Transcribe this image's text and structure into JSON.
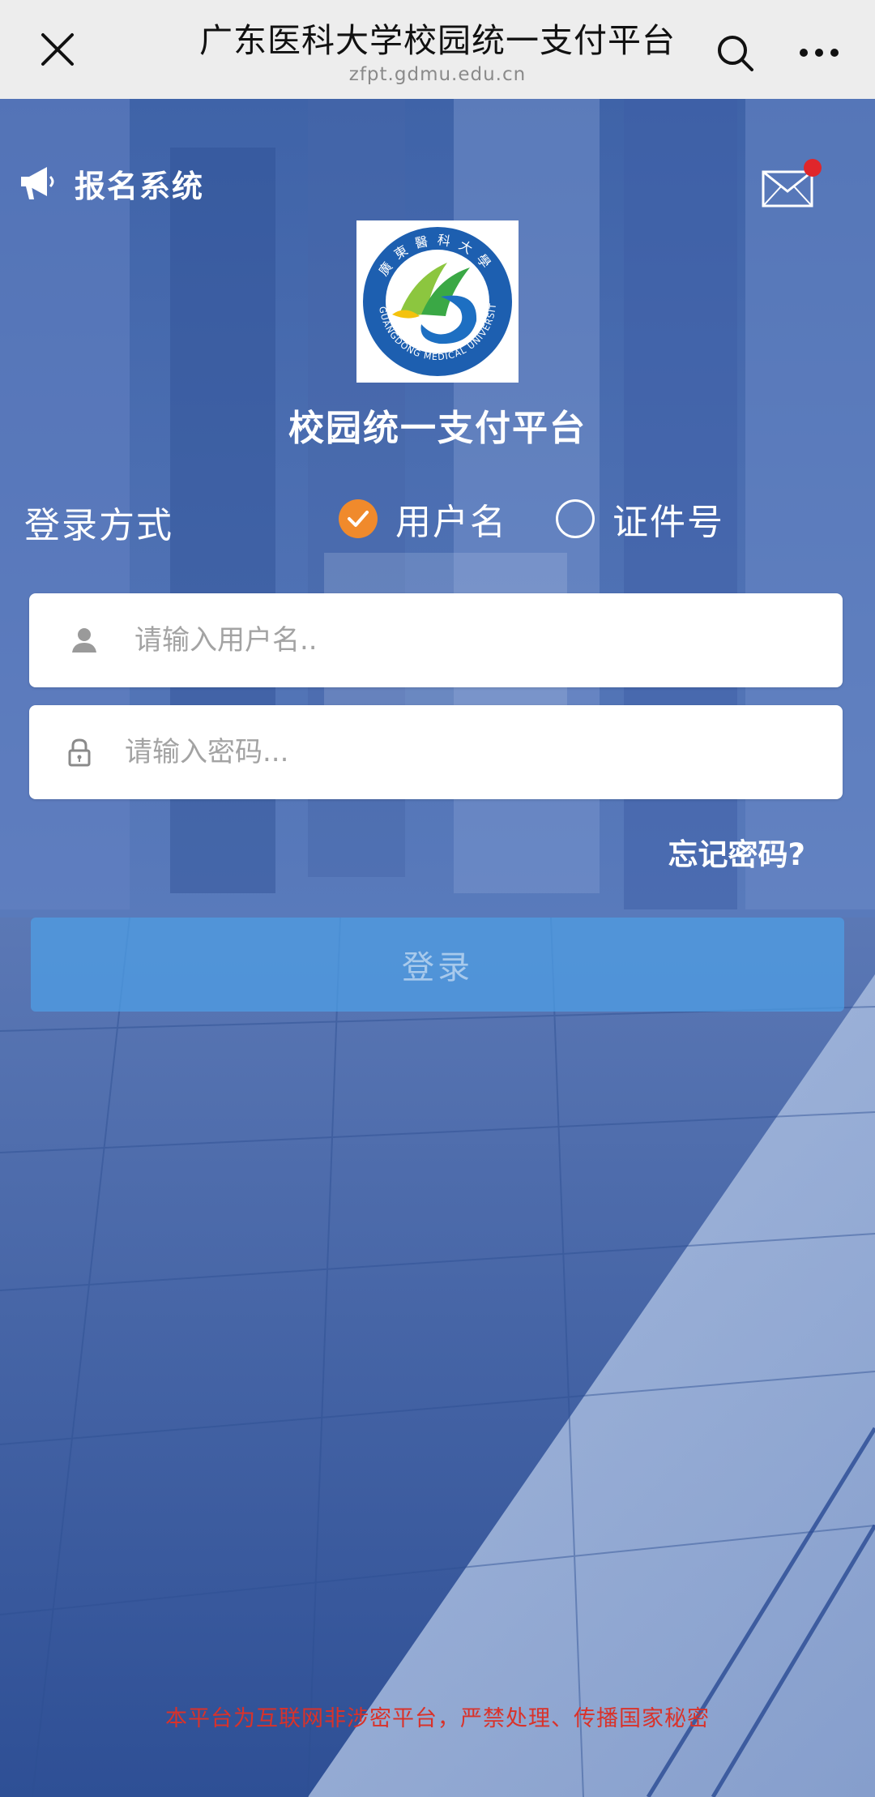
{
  "browser": {
    "title": "广东医科大学校园统一支付平台",
    "url": "zfpt.gdmu.edu.cn"
  },
  "header": {
    "system_label": "报名系统"
  },
  "logo": {
    "ring_text": "GUANGDONG MEDICAL UNIVERSITY",
    "calligraphy": "廣東醫科大學"
  },
  "app_title": "校园统一支付平台",
  "login": {
    "method_label": "登录方式",
    "options": [
      {
        "label": "用户名",
        "checked": true
      },
      {
        "label": "证件号",
        "checked": false
      }
    ],
    "username_placeholder": "请输入用户名..",
    "password_placeholder": "请输入密码...",
    "forgot_label": "忘记密码?",
    "submit_label": "登录"
  },
  "footer_notice": "本平台为互联网非涉密平台，严禁处理、传播国家秘密",
  "colors": {
    "accent_orange": "#f08a2c",
    "notice_red": "#d9322a",
    "login_button": "#4ea0e6",
    "notification_dot": "#e0262b"
  }
}
